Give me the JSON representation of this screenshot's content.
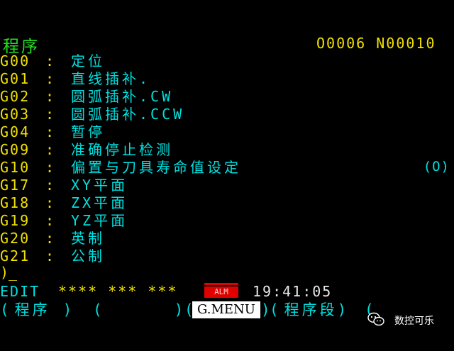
{
  "header": {
    "title": "程序",
    "program_number": "O0006 N00010"
  },
  "gcodes": [
    {
      "code": "G00",
      "desc": "定位"
    },
    {
      "code": "G01",
      "desc": "直线插补."
    },
    {
      "code": "G02",
      "desc": "圆弧插补.CW"
    },
    {
      "code": "G03",
      "desc": "圆弧插补.CCW"
    },
    {
      "code": "G04",
      "desc": "暂停"
    },
    {
      "code": "G09",
      "desc": "准确停止检测"
    },
    {
      "code": "G10",
      "desc": "偏置与刀具寿命值设定"
    },
    {
      "code": "G17",
      "desc": "XY平面"
    },
    {
      "code": "G18",
      "desc": "ZX平面"
    },
    {
      "code": "G19",
      "desc": "YZ平面"
    },
    {
      "code": "G20",
      "desc": "英制"
    },
    {
      "code": "G21",
      "desc": "公制"
    }
  ],
  "colon": ":",
  "side_label": "(O)",
  "prompt": ")_",
  "status": {
    "mode": "EDIT",
    "stars": "**** *** ***",
    "alarm": "ALM",
    "time": "19:41:05"
  },
  "softkeys": {
    "k1": "程序",
    "k2": "",
    "k3": "G.MENU",
    "k4": "程序段",
    "k5": ""
  },
  "watermark": {
    "text": "数控可乐",
    "icon": "wechat-icon"
  },
  "colors": {
    "yellow": "#f0e000",
    "cyan": "#00e0e0",
    "green": "#22e022",
    "alarm_red": "#e00000"
  }
}
